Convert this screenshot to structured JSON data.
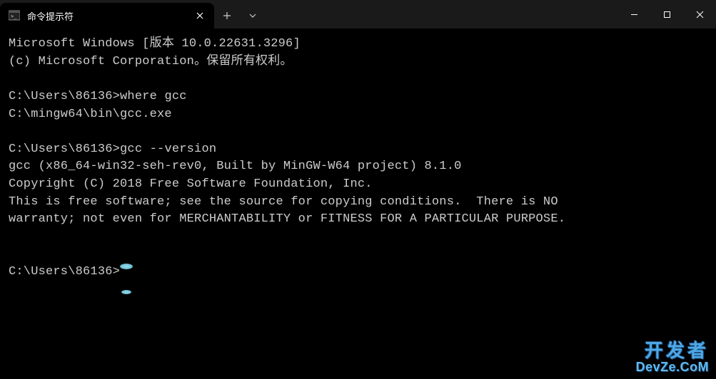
{
  "tab": {
    "title": "命令提示符"
  },
  "terminal": {
    "line1": "Microsoft Windows [版本 10.0.22631.3296]",
    "line2": "(c) Microsoft Corporation。保留所有权利。",
    "blank1": "",
    "prompt1": "C:\\Users\\86136>",
    "cmd1": "where gcc",
    "out1": "C:\\mingw64\\bin\\gcc.exe",
    "blank2": "",
    "prompt2": "C:\\Users\\86136>",
    "cmd2": "gcc --version",
    "out2a": "gcc (x86_64-win32-seh-rev0, Built by MinGW-W64 project) 8.1.0",
    "out2b": "Copyright (C) 2018 Free Software Foundation, Inc.",
    "out2c": "This is free software; see the source for copying conditions.  There is NO",
    "out2d": "warranty; not even for MERCHANTABILITY or FITNESS FOR A PARTICULAR PURPOSE.",
    "blank3": "",
    "blank4": "",
    "prompt3": "C:\\Users\\86136>"
  },
  "watermark": {
    "cn": "开发者",
    "en": "DevZe.CoM"
  }
}
